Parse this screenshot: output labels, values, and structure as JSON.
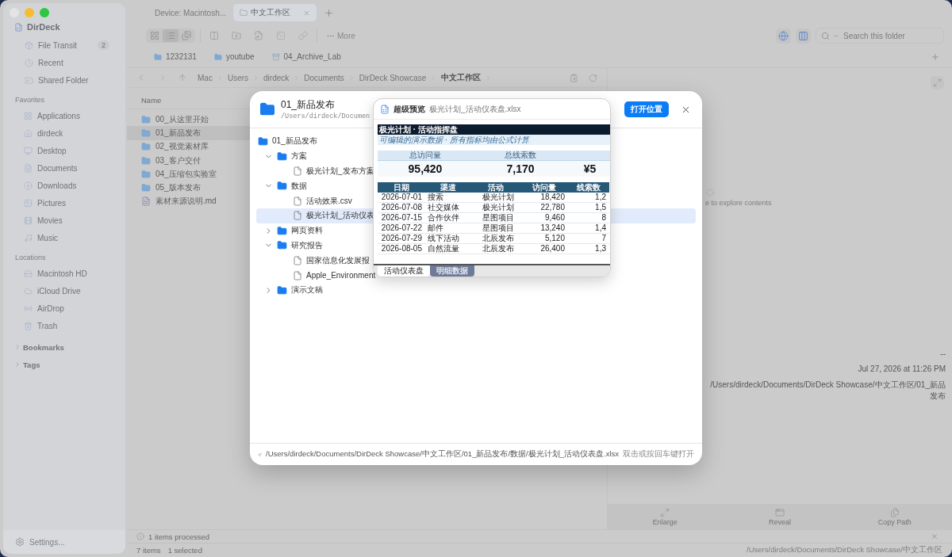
{
  "tabs": [
    {
      "label": "Device: Macintosh...",
      "selected": false
    },
    {
      "label": "中文工作区",
      "selected": true
    }
  ],
  "toolbar": {
    "view_modes": [
      {
        "kind": "grid",
        "selected": false
      },
      {
        "kind": "list",
        "selected": true
      },
      {
        "kind": "gallery",
        "selected": false
      }
    ],
    "more_label": "More",
    "search": {
      "placeholder": "Search this folder"
    }
  },
  "bookmarks": [
    {
      "label": "1232131",
      "kind": "folder"
    },
    {
      "label": "youtube",
      "kind": "folder"
    },
    {
      "label": "04_Archive_Lab",
      "kind": "archive"
    }
  ],
  "breadcrumb": [
    {
      "label": "Mac",
      "selected": false
    },
    {
      "label": "Users",
      "selected": false
    },
    {
      "label": "dirdeck",
      "selected": false
    },
    {
      "label": "Documents",
      "selected": false
    },
    {
      "label": "DirDeck Showcase",
      "selected": false
    },
    {
      "label": "中文工作区",
      "selected": true
    }
  ],
  "sidebar": {
    "app_name": "DirDeck",
    "top_items": [
      {
        "label": "File Transit",
        "kind": "box",
        "badge": "2"
      },
      {
        "label": "Recent",
        "kind": "clock"
      },
      {
        "label": "Shared Folder",
        "kind": "shared"
      }
    ],
    "sections": [
      {
        "title": "Favorites",
        "items": [
          {
            "label": "Applications",
            "kind": "apps"
          },
          {
            "label": "dirdeck",
            "kind": "home"
          },
          {
            "label": "Desktop",
            "kind": "desktop"
          },
          {
            "label": "Documents",
            "kind": "document"
          },
          {
            "label": "Downloads",
            "kind": "download"
          },
          {
            "label": "Pictures",
            "kind": "picture"
          },
          {
            "label": "Movies",
            "kind": "movie"
          },
          {
            "label": "Music",
            "kind": "music"
          }
        ]
      },
      {
        "title": "Locations",
        "items": [
          {
            "label": "Macintosh HD",
            "kind": "disk"
          },
          {
            "label": "iCloud Drive",
            "kind": "cloud"
          },
          {
            "label": "AirDrop",
            "kind": "airdrop"
          },
          {
            "label": "Trash",
            "kind": "trash"
          }
        ]
      }
    ],
    "groups": [
      {
        "label": "Bookmarks",
        "expanded": false
      },
      {
        "label": "Tags",
        "expanded": false
      }
    ],
    "settings_label": "Settings..."
  },
  "file_list": {
    "column": "Name",
    "rows": [
      {
        "name": "00_从这里开始",
        "kind": "folder",
        "selected": false
      },
      {
        "name": "01_新品发布",
        "kind": "folder",
        "selected": true
      },
      {
        "name": "02_视觉素材库",
        "kind": "folder",
        "selected": false
      },
      {
        "name": "03_客户交付",
        "kind": "folder",
        "selected": false
      },
      {
        "name": "04_压缩包实验室",
        "kind": "folder",
        "selected": false
      },
      {
        "name": "05_版本发布",
        "kind": "folder",
        "selected": false
      },
      {
        "name": "素材来源说明.md",
        "kind": "file",
        "selected": false
      }
    ]
  },
  "preview_panel": {
    "hint": "e to explore contents",
    "size": "--",
    "modified": "Jul 27, 2026 at 11:26 PM",
    "path": "/Users/dirdeck/Documents/DirDeck Showcase/中文工作区/01_新品发布",
    "actions": [
      {
        "label": "Enlarge",
        "kind": "enlarge"
      },
      {
        "label": "Reveal",
        "kind": "reveal"
      },
      {
        "label": "Copy Path",
        "kind": "copy"
      }
    ]
  },
  "status": {
    "message": "1 items processed",
    "count": "7 items",
    "selection": "1 selected",
    "path": "/Users/dirdeck/Documents/DirDeck Showcase/中文工作区"
  },
  "dialog": {
    "title": "01_新品发布",
    "subtitle": "/Users/dirdeck/Documen",
    "open_button": "打开位置",
    "tree": {
      "label": "01_新品发布",
      "kind": "folder",
      "selected": false,
      "children": [
        {
          "label": "方案",
          "kind": "folder",
          "expanded": true,
          "selected": false,
          "children": [
            {
              "label": "极光计划_发布方案",
              "kind": "file",
              "selected": false
            }
          ]
        },
        {
          "label": "数据",
          "kind": "folder",
          "expanded": true,
          "selected": false,
          "children": [
            {
              "label": "活动效果.csv",
              "kind": "file",
              "selected": false
            },
            {
              "label": "极光计划_活动仪表",
              "kind": "file",
              "selected": true
            }
          ]
        },
        {
          "label": "网页资料",
          "kind": "folder",
          "expanded": false,
          "selected": false
        },
        {
          "label": "研究报告",
          "kind": "folder",
          "expanded": true,
          "selected": false,
          "children": [
            {
              "label": "国家信息化发展报",
              "kind": "file",
              "selected": false
            },
            {
              "label": "Apple_Environment",
              "kind": "file",
              "selected": false
            }
          ]
        },
        {
          "label": "演示文稿",
          "kind": "folder",
          "expanded": false,
          "selected": false
        }
      ]
    },
    "footer_path": "/Users/dirdeck/Documents/DirDeck Showcase/中文工作区/01_新品发布/数据/极光计划_活动仪表盘.xlsx",
    "footer_hint": "双击或按回车键打开"
  },
  "quick_look": {
    "title": "超级预览",
    "file": "极光计划_活动仪表盘.xlsx",
    "sheet": {
      "heading": "极光计划 · 活动指挥盘",
      "subheading": "可编辑的演示数据 · 所有指标均由公式计算",
      "kpis": [
        {
          "label": "总访问量",
          "value": "95,420"
        },
        {
          "label": "总线索数",
          "value": "7,170"
        },
        {
          "value": "¥5"
        }
      ],
      "columns": [
        "日期",
        "渠道",
        "活动",
        "访问量",
        "线索数"
      ],
      "rows": [
        [
          "2026-07-01",
          "搜索",
          "极光计划",
          "18,420",
          "1,2"
        ],
        [
          "2026-07-08",
          "社交媒体",
          "极光计划",
          "22,780",
          "1,5"
        ],
        [
          "2026-07-15",
          "合作伙伴",
          "星图项目",
          "9,460",
          "8"
        ],
        [
          "2026-07-22",
          "邮件",
          "星图项目",
          "13,240",
          "1,4"
        ],
        [
          "2026-07-29",
          "线下活动",
          "北辰发布",
          "5,120",
          "7"
        ],
        [
          "2026-08-05",
          "自然流量",
          "北辰发布",
          "26,400",
          "1,3"
        ]
      ]
    },
    "sheet_tabs": [
      {
        "label": "活动仪表盘",
        "selected": true
      },
      {
        "label": "明细数据",
        "selected": false
      }
    ]
  }
}
